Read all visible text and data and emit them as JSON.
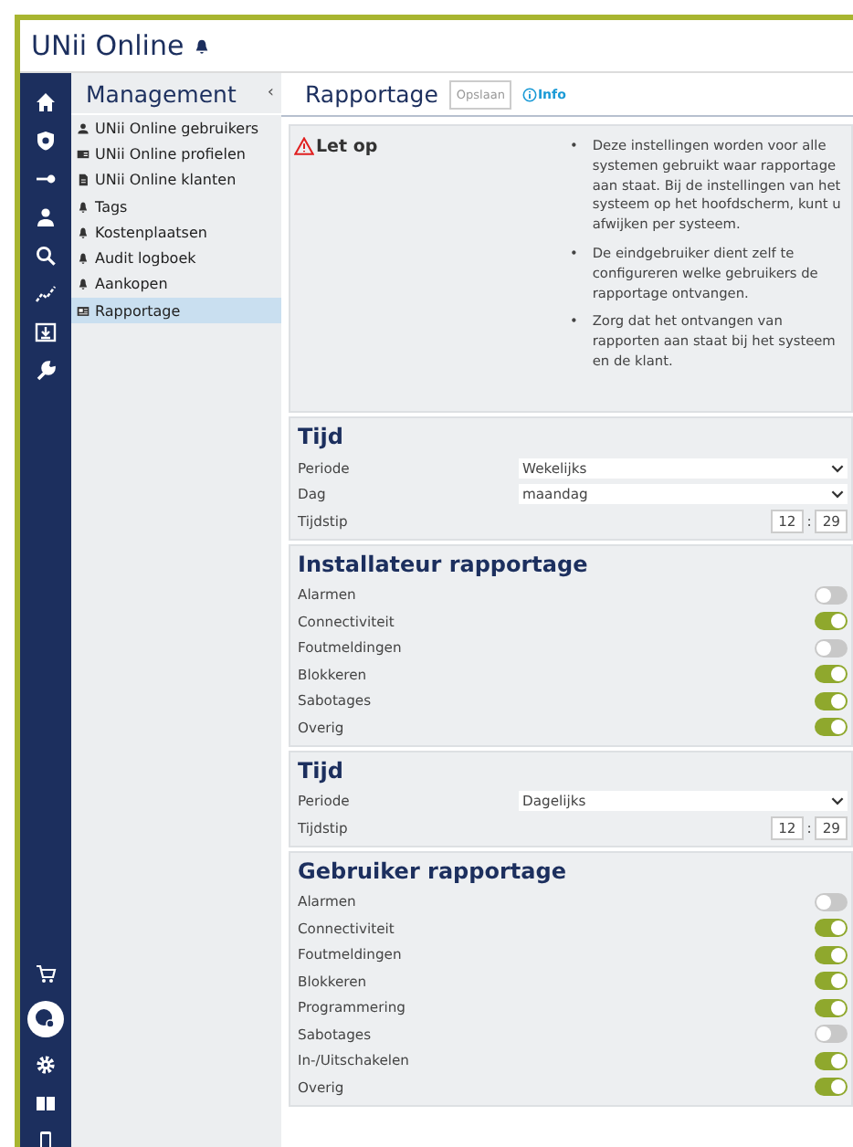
{
  "app": {
    "title": "UNii Online"
  },
  "submenu": {
    "title": "Management",
    "collapse": "‹",
    "items": [
      {
        "label": "UNii Online gebruikers",
        "kind": "person",
        "selected": false
      },
      {
        "label": "UNii Online profielen",
        "kind": "card",
        "selected": false
      },
      {
        "label": "UNii Online klanten",
        "kind": "doc",
        "selected": false
      },
      {
        "label": "Tags",
        "kind": "bell",
        "selected": false
      },
      {
        "label": "Kostenplaatsen",
        "kind": "bell",
        "selected": false
      },
      {
        "label": "Audit logboek",
        "kind": "bell",
        "selected": false
      },
      {
        "label": "Aankopen",
        "kind": "bell",
        "selected": false
      },
      {
        "label": "Rapportage",
        "kind": "report",
        "selected": true
      }
    ]
  },
  "page": {
    "title": "Rapportage",
    "save_button": "Opslaan",
    "info_link": "Info"
  },
  "notice": {
    "title": "Let op",
    "marker": "•",
    "bullets": [
      "Deze instellingen worden voor alle systemen gebruikt waar rapportage aan staat. Bij de instellingen van het systeem op het hoofdscherm, kunt u afwijken per systeem.",
      "De eindgebruiker dient zelf te configureren welke gebruikers de rapportage ontvangen.",
      "Zorg dat het ontvangen van rapporten aan staat bij het systeem en de klant."
    ]
  },
  "sections": [
    {
      "title": "Tijd",
      "rows": [
        {
          "kind": "select",
          "label": "Periode",
          "value": "Wekelijks"
        },
        {
          "kind": "select",
          "label": "Dag",
          "value": "maandag"
        },
        {
          "kind": "time",
          "label": "Tijdstip",
          "hours": "12",
          "separator": ":",
          "minutes": "29"
        }
      ]
    },
    {
      "title": "Installateur rapportage",
      "rows": [
        {
          "kind": "toggle",
          "label": "Alarmen",
          "on": false
        },
        {
          "kind": "toggle",
          "label": "Connectiviteit",
          "on": true
        },
        {
          "kind": "toggle",
          "label": "Foutmeldingen",
          "on": false
        },
        {
          "kind": "toggle",
          "label": "Blokkeren",
          "on": true
        },
        {
          "kind": "toggle",
          "label": "Sabotages",
          "on": true
        },
        {
          "kind": "toggle",
          "label": "Overig",
          "on": true
        }
      ]
    },
    {
      "title": "Tijd",
      "rows": [
        {
          "kind": "select",
          "label": "Periode",
          "value": "Dagelijks"
        },
        {
          "kind": "time",
          "label": "Tijdstip",
          "hours": "12",
          "separator": ":",
          "minutes": "29"
        }
      ]
    },
    {
      "title": "Gebruiker rapportage",
      "rows": [
        {
          "kind": "toggle",
          "label": "Alarmen",
          "on": false
        },
        {
          "kind": "toggle",
          "label": "Connectiviteit",
          "on": true
        },
        {
          "kind": "toggle",
          "label": "Foutmeldingen",
          "on": true
        },
        {
          "kind": "toggle",
          "label": "Blokkeren",
          "on": true
        },
        {
          "kind": "toggle",
          "label": "Programmering",
          "on": true
        },
        {
          "kind": "toggle",
          "label": "Sabotages",
          "on": false
        },
        {
          "kind": "toggle",
          "label": "In-/Uitschakelen",
          "on": true
        },
        {
          "kind": "toggle",
          "label": "Overig",
          "on": true
        }
      ]
    }
  ]
}
